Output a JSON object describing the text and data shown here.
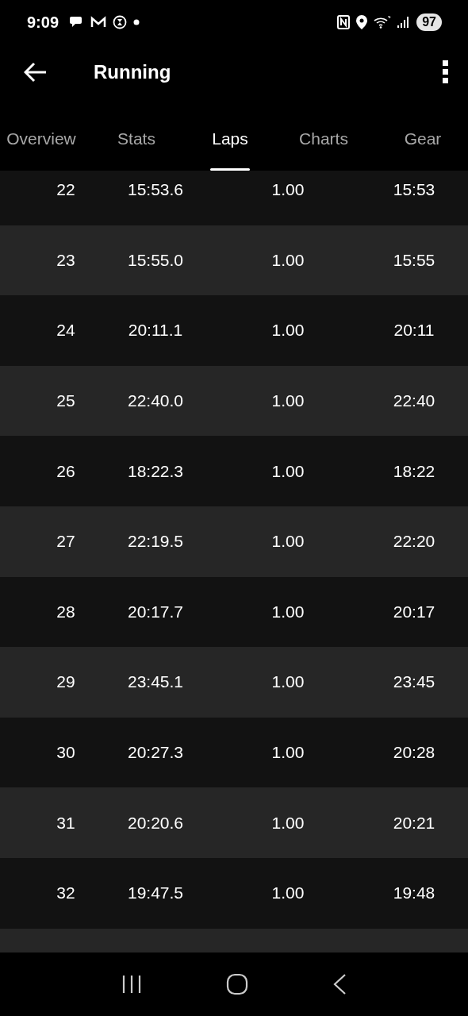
{
  "status_bar": {
    "time": "9:09",
    "battery": "97"
  },
  "app_bar": {
    "title": "Running"
  },
  "tabs": [
    {
      "label": "Overview",
      "selected": false
    },
    {
      "label": "Stats",
      "selected": false
    },
    {
      "label": "Laps",
      "selected": true
    },
    {
      "label": "Charts",
      "selected": false
    },
    {
      "label": "Gear",
      "selected": false
    }
  ],
  "laps": [
    {
      "lap": "22",
      "time": "15:53.6",
      "distance": "1.00",
      "pace": "15:53"
    },
    {
      "lap": "23",
      "time": "15:55.0",
      "distance": "1.00",
      "pace": "15:55"
    },
    {
      "lap": "24",
      "time": "20:11.1",
      "distance": "1.00",
      "pace": "20:11"
    },
    {
      "lap": "25",
      "time": "22:40.0",
      "distance": "1.00",
      "pace": "22:40"
    },
    {
      "lap": "26",
      "time": "18:22.3",
      "distance": "1.00",
      "pace": "18:22"
    },
    {
      "lap": "27",
      "time": "22:19.5",
      "distance": "1.00",
      "pace": "22:20"
    },
    {
      "lap": "28",
      "time": "20:17.7",
      "distance": "1.00",
      "pace": "20:17"
    },
    {
      "lap": "29",
      "time": "23:45.1",
      "distance": "1.00",
      "pace": "23:45"
    },
    {
      "lap": "30",
      "time": "20:27.3",
      "distance": "1.00",
      "pace": "20:28"
    },
    {
      "lap": "31",
      "time": "20:20.6",
      "distance": "1.00",
      "pace": "20:21"
    },
    {
      "lap": "32",
      "time": "19:47.5",
      "distance": "1.00",
      "pace": "19:48"
    }
  ]
}
